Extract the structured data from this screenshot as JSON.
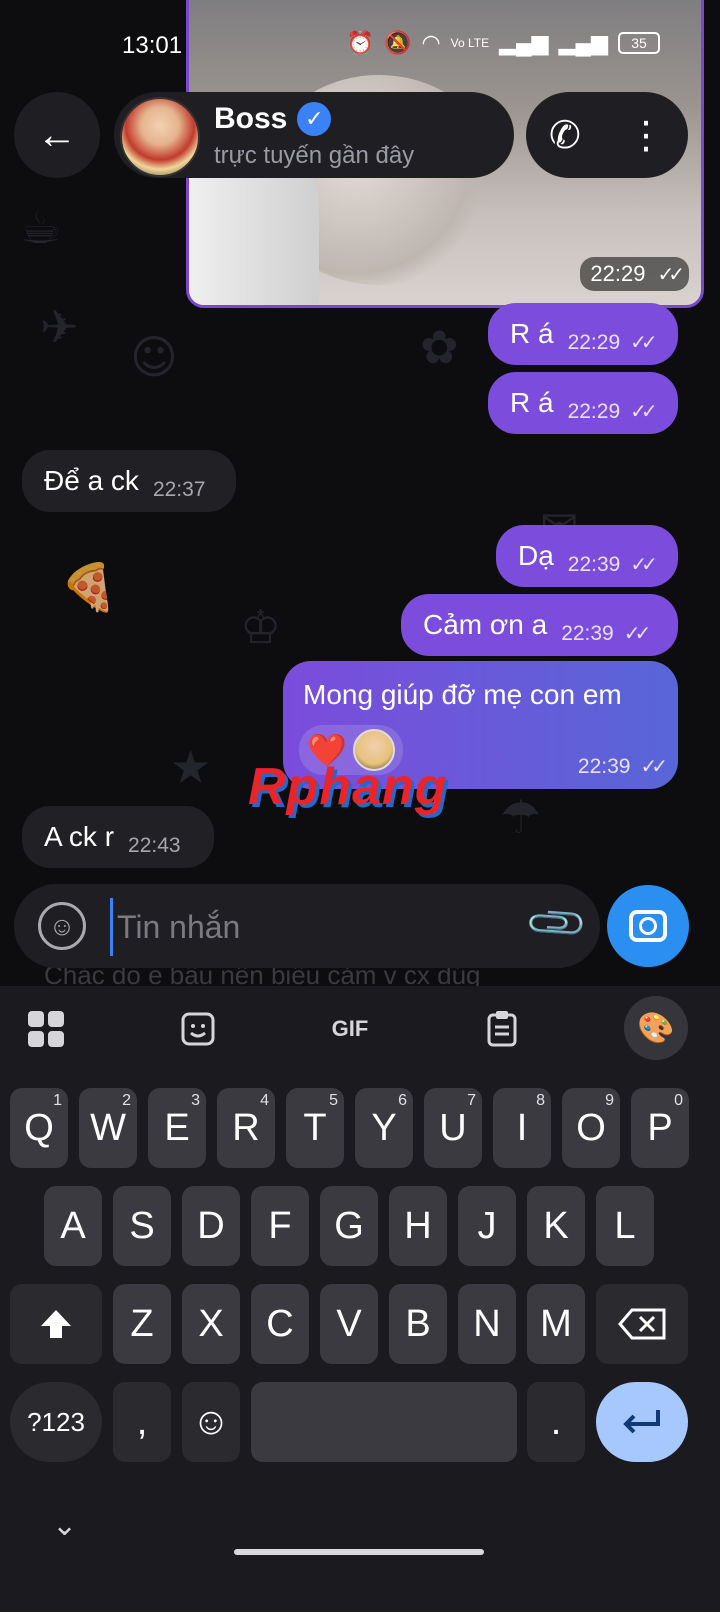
{
  "status_bar": {
    "time": "13:01",
    "battery": "35",
    "network": "Vo LTE"
  },
  "header": {
    "contact_name": "Boss",
    "contact_status": "trực tuyến gần đây"
  },
  "image_message": {
    "time": "22:29"
  },
  "messages": [
    {
      "dir": "out",
      "text": "R á",
      "time": "22:29"
    },
    {
      "dir": "out",
      "text": "R á",
      "time": "22:29"
    },
    {
      "dir": "in",
      "text": "Để a ck",
      "time": "22:37"
    },
    {
      "dir": "out",
      "text": "Dạ",
      "time": "22:39"
    },
    {
      "dir": "out",
      "text": "Cảm ơn a",
      "time": "22:39"
    },
    {
      "dir": "out",
      "text": "Mong giúp đỡ mẹ con em",
      "time": "22:39",
      "reaction": "❤️"
    },
    {
      "dir": "in",
      "text": "A ck r",
      "time": "22:43"
    }
  ],
  "watermark": "Rphang",
  "ghost_text": "Chắc do e bầu nên biểu cảm v cx dúg",
  "composer": {
    "placeholder": "Tin nhắn"
  },
  "keyboard": {
    "toolbar": {
      "gif": "GIF"
    },
    "row1": [
      {
        "k": "Q",
        "n": "1"
      },
      {
        "k": "W",
        "n": "2"
      },
      {
        "k": "E",
        "n": "3"
      },
      {
        "k": "R",
        "n": "4"
      },
      {
        "k": "T",
        "n": "5"
      },
      {
        "k": "Y",
        "n": "6"
      },
      {
        "k": "U",
        "n": "7"
      },
      {
        "k": "I",
        "n": "8"
      },
      {
        "k": "O",
        "n": "9"
      },
      {
        "k": "P",
        "n": "0"
      }
    ],
    "row2": [
      "A",
      "S",
      "D",
      "F",
      "G",
      "H",
      "J",
      "K",
      "L"
    ],
    "row3": [
      "Z",
      "X",
      "C",
      "V",
      "B",
      "N",
      "M"
    ],
    "symbols_key": "?123",
    "comma_key": ",",
    "period_key": "."
  },
  "icons": {
    "back": "arrow-left",
    "verified": "check-badge",
    "call": "phone",
    "menu": "more-vertical",
    "emoji": "smile",
    "attach": "paperclip",
    "camera": "camera",
    "apps": "grid",
    "sticker": "sticker",
    "clipboard": "clipboard",
    "theme": "palette",
    "shift": "shift",
    "backspace": "backspace",
    "enter": "enter",
    "collapse": "chevron-down"
  },
  "colors": {
    "outgoing_bubble": "#7c4ddc",
    "incoming_bubble": "#212125",
    "accent": "#2a8ff0"
  }
}
